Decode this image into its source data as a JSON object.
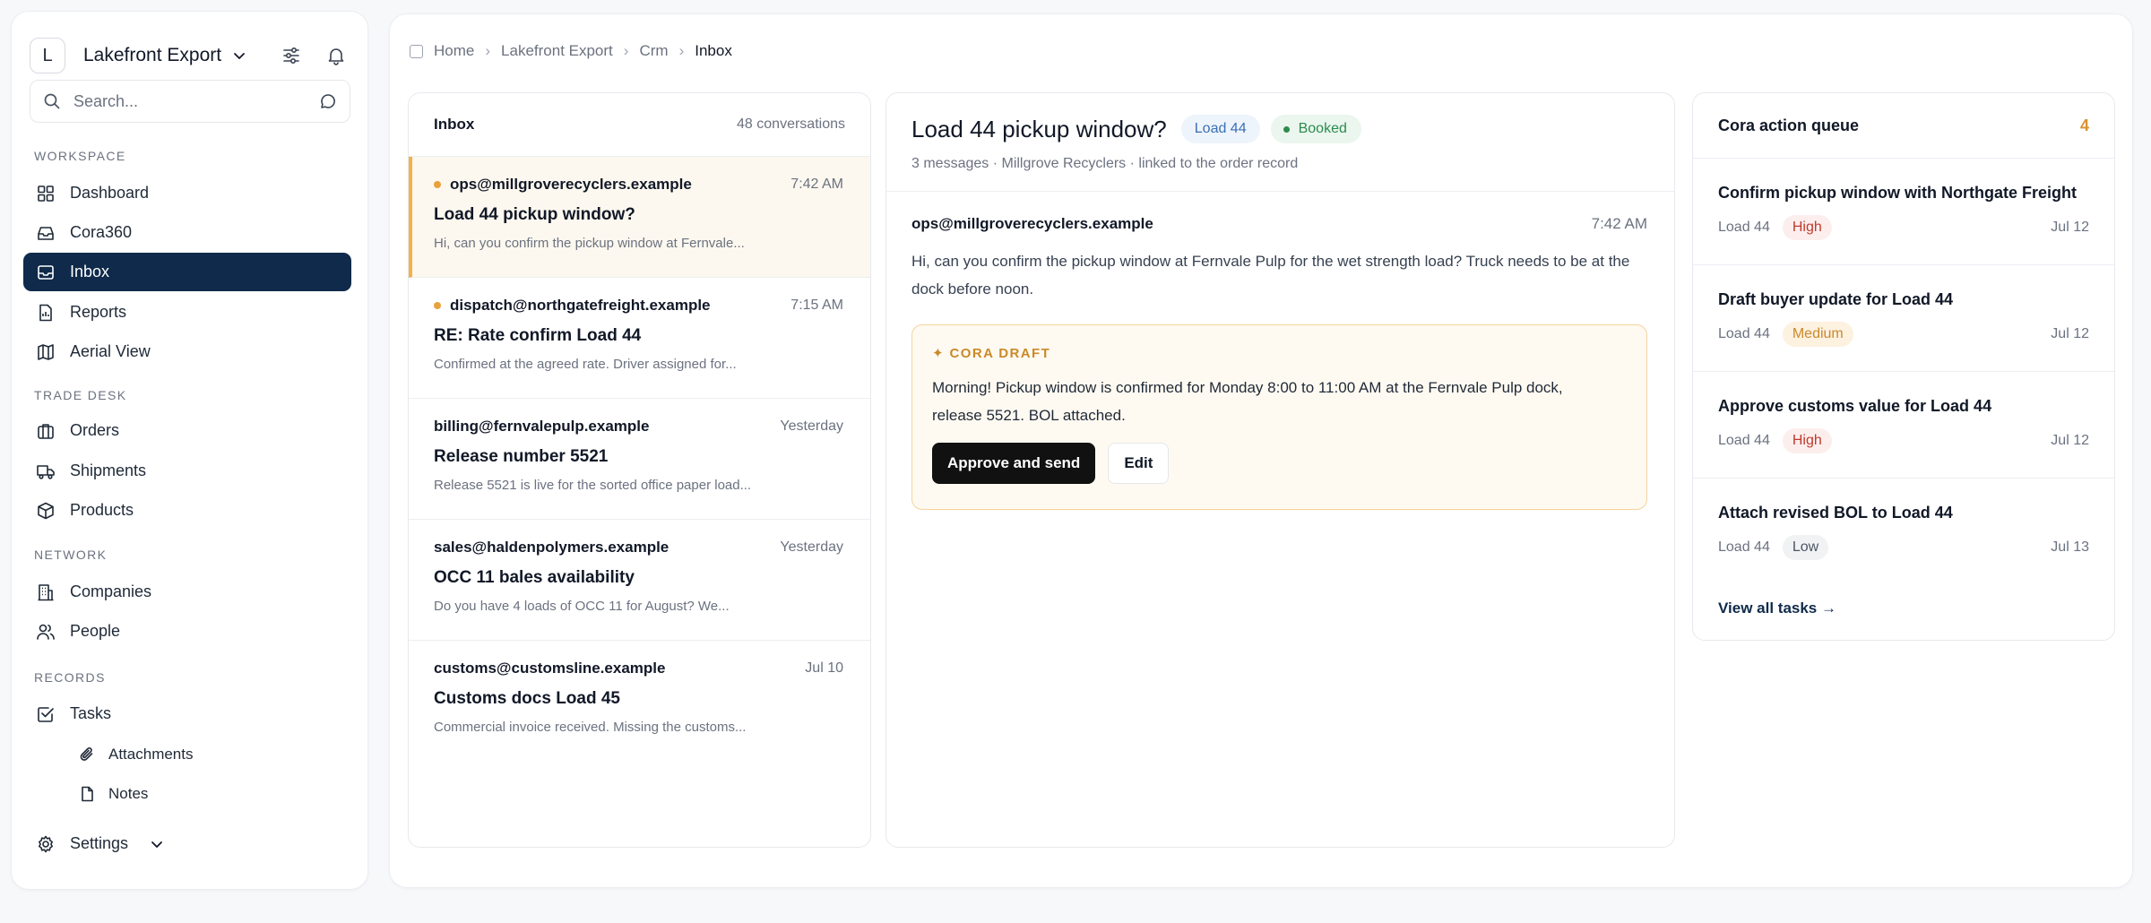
{
  "workspace": {
    "avatar_letter": "L",
    "name": "Lakefront Export"
  },
  "search": {
    "placeholder": "Search..."
  },
  "sidebar": {
    "sections": {
      "workspace": "WORKSPACE",
      "trade_desk": "TRADE DESK",
      "network": "NETWORK",
      "records": "RECORDS"
    },
    "items": {
      "dashboard": "Dashboard",
      "cora360": "Cora360",
      "inbox": "Inbox",
      "reports": "Reports",
      "aerial_view": "Aerial View",
      "orders": "Orders",
      "shipments": "Shipments",
      "products": "Products",
      "companies": "Companies",
      "people": "People",
      "tasks": "Tasks",
      "attachments": "Attachments",
      "notes": "Notes",
      "settings": "Settings"
    },
    "active": "inbox"
  },
  "breadcrumb": [
    "Home",
    "Lakefront Export",
    "Crm",
    "Inbox"
  ],
  "inbox": {
    "title": "Inbox",
    "count": "48 conversations",
    "messages": [
      {
        "sender": "ops@millgroverecyclers.example",
        "time": "7:42 AM",
        "subject": "Load 44 pickup window?",
        "preview": "Hi, can you confirm the pickup window at Fernvale...",
        "unread": true,
        "selected": true
      },
      {
        "sender": "dispatch@northgatefreight.example",
        "time": "7:15 AM",
        "subject": "RE: Rate confirm Load 44",
        "preview": "Confirmed at the agreed rate. Driver assigned for...",
        "unread": true,
        "selected": false
      },
      {
        "sender": "billing@fernvalepulp.example",
        "time": "Yesterday",
        "subject": "Release number 5521",
        "preview": "Release 5521 is live for the sorted office paper load...",
        "unread": false,
        "selected": false
      },
      {
        "sender": "sales@haldenpolymers.example",
        "time": "Yesterday",
        "subject": "OCC 11 bales availability",
        "preview": "Do you have 4 loads of OCC 11 for August? We...",
        "unread": false,
        "selected": false
      },
      {
        "sender": "customs@customsline.example",
        "time": "Jul 10",
        "subject": "Customs docs Load 45",
        "preview": "Commercial invoice received. Missing the customs...",
        "unread": false,
        "selected": false
      }
    ]
  },
  "thread": {
    "title": "Load 44 pickup window?",
    "load_tag": "Load 44",
    "status": "Booked",
    "meta": "3 messages · Millgrove Recyclers · linked to the order record",
    "message": {
      "from": "ops@millgroverecyclers.example",
      "time": "7:42 AM",
      "body": "Hi, can you confirm the pickup window at Fernvale Pulp for the wet strength load? Truck needs to be at the dock before noon."
    },
    "draft": {
      "label": "✦ CORA DRAFT",
      "body_line1": "Morning! Pickup window is confirmed for Monday 8:00 to 11:00 AM at the Fernvale Pulp dock,",
      "body_line2": "release 5521. BOL attached.",
      "approve_label": "Approve and send",
      "edit_label": "Edit"
    }
  },
  "queue": {
    "title": "Cora action queue",
    "count": "4",
    "tasks": [
      {
        "title": "Confirm pickup window with Northgate Freight",
        "load": "Load 44",
        "priority": "High",
        "date": "Jul 12"
      },
      {
        "title": "Draft buyer update for Load 44",
        "load": "Load 44",
        "priority": "Medium",
        "date": "Jul 12"
      },
      {
        "title": "Approve customs value for Load 44",
        "load": "Load 44",
        "priority": "High",
        "date": "Jul 12"
      },
      {
        "title": "Attach revised BOL to Load 44",
        "load": "Load 44",
        "priority": "Low",
        "date": "Jul 13"
      }
    ],
    "view_all": "View all tasks →"
  },
  "colors": {
    "active_nav": "#0f2a4a",
    "accent_amber": "#e8a23b",
    "booked_green": "#2e8a4e",
    "high_red": "#c0392b"
  },
  "icons": {
    "dashboard": "grid-icon",
    "cora360": "inbox-tray-icon",
    "inbox": "inbox-icon",
    "reports": "report-icon",
    "aerial_view": "map-icon",
    "orders": "briefcase-icon",
    "shipments": "truck-icon",
    "products": "box-icon",
    "companies": "building-icon",
    "people": "people-icon",
    "tasks": "checkbox-icon",
    "attachments": "paperclip-icon",
    "notes": "file-icon",
    "settings": "gear-icon"
  }
}
